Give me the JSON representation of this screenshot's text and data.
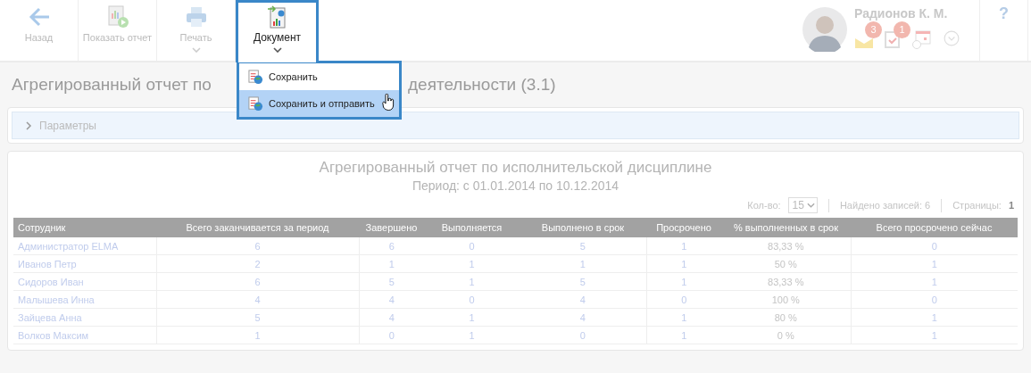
{
  "toolbar": {
    "buttons": [
      {
        "kind": "back",
        "label": "Назад",
        "dropdown": false,
        "selected": false
      },
      {
        "kind": "show",
        "label": "Показать отчет",
        "dropdown": false,
        "selected": false
      },
      {
        "kind": "print",
        "label": "Печать",
        "dropdown": true,
        "selected": false
      },
      {
        "kind": "document",
        "label": "Документ",
        "dropdown": true,
        "selected": true
      }
    ]
  },
  "document_menu": {
    "items": [
      {
        "label": "Сохранить",
        "selected": false
      },
      {
        "label": "Сохранить и отправить",
        "selected": true
      }
    ]
  },
  "user": {
    "name": "Радионов К. М.",
    "indicators": [
      {
        "kind": "mail",
        "count": "3"
      },
      {
        "kind": "tasks",
        "count": "1"
      },
      {
        "kind": "calendar"
      },
      {
        "kind": "more"
      }
    ]
  },
  "help": "?",
  "page_title": {
    "visible_start": "Агрегированный отчет по",
    "visible_end": "деятельности (3.1)"
  },
  "parameters": {
    "label": "Параметры",
    "expanded": false
  },
  "report": {
    "title": "Агрегированный отчет по исполнительской дисциплине",
    "period": "Период: с 01.01.2014 по 10.12.2014",
    "pager": {
      "count_label": "Кол-во:",
      "count_value": "15",
      "found": "Найдено записей: 6",
      "pages_label": "Страницы:",
      "page": "1"
    },
    "table": {
      "columns": [
        "Сотрудник",
        "Всего заканчивается за период",
        "Завершено",
        "Выполняется",
        "Выполнено в срок",
        "Просрочено",
        "% выполненных в срок",
        "Всего просрочено сейчас"
      ],
      "rows": [
        [
          "Администратор ELMA",
          "6",
          "6",
          "0",
          "5",
          "1",
          "83,33 %",
          "0"
        ],
        [
          "Иванов Петр",
          "2",
          "1",
          "1",
          "1",
          "1",
          "50 %",
          "1"
        ],
        [
          "Сидоров Иван",
          "6",
          "5",
          "1",
          "5",
          "1",
          "83,33 %",
          "1"
        ],
        [
          "Малышева Инна",
          "4",
          "4",
          "0",
          "4",
          "0",
          "100 %",
          "0"
        ],
        [
          "Зайцева Анна",
          "5",
          "4",
          "1",
          "4",
          "1",
          "80 %",
          "1"
        ],
        [
          "Волков Максим",
          "1",
          "0",
          "1",
          "0",
          "1",
          "0 %",
          "1"
        ]
      ]
    }
  }
}
